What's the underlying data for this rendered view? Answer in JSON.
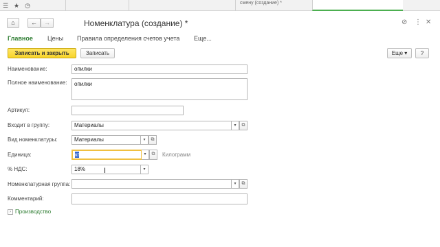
{
  "topbar": {
    "tabs": [
      {
        "label": ""
      },
      {
        "label": ""
      },
      {
        "label": "смену (создание) *"
      },
      {
        "label": ""
      }
    ]
  },
  "header": {
    "back": "←",
    "forward": "→",
    "home": "⌂",
    "title": "Номенклатура (создание) *",
    "link_icon": "🔗",
    "more_icon": "⋮",
    "close_icon": "✕"
  },
  "sections": [
    "Главное",
    "Цены",
    "Правила определения счетов учета",
    "Еще..."
  ],
  "commands": {
    "save_close": "Записать и закрыть",
    "save": "Записать",
    "more": "Еще",
    "help": "?"
  },
  "form": {
    "name_label": "Наименование:",
    "name_value": "опилки",
    "full_name_label": "Полное наименование:",
    "full_name_value": "опилки",
    "article_label": "Артикул:",
    "article_value": "",
    "group_label": "Входит в группу:",
    "group_value": "Материалы",
    "kind_label": "Вид номенклатуры:",
    "kind_value": "Материалы",
    "unit_label": "Единица:",
    "unit_value": "кг",
    "unit_hint": "Килограмм",
    "vat_label": "% НДС:",
    "vat_value": "18%",
    "nom_group_label": "Номенклатурная группа:",
    "nom_group_value": "",
    "comment_label": "Комментарий:",
    "comment_value": "",
    "production_link": "Производство"
  }
}
